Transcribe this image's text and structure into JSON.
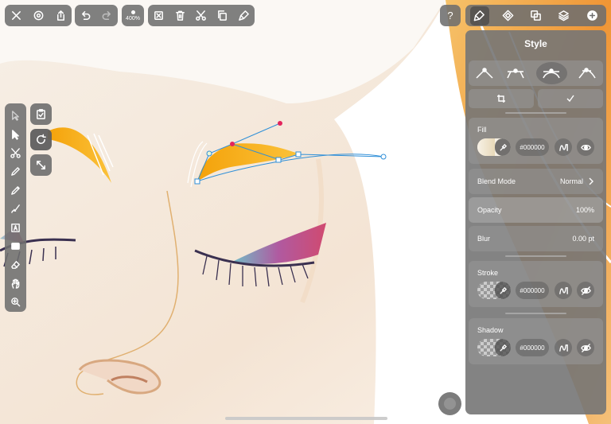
{
  "app": {
    "zoom": "400%"
  },
  "panel": {
    "title": "Style",
    "fill": {
      "label": "Fill",
      "hex": "#000000"
    },
    "blend_mode": {
      "label": "Blend Mode",
      "value": "Normal"
    },
    "opacity": {
      "label": "Opacity",
      "value": "100%"
    },
    "blur": {
      "label": "Blur",
      "value": "0.00 pt"
    },
    "stroke": {
      "label": "Stroke",
      "hex": "#000000"
    },
    "shadow": {
      "label": "Shadow",
      "hex": "#000000"
    }
  },
  "help_label": "?",
  "colors": {
    "toolbar": "#6e6e6e",
    "panel": "#767676",
    "brow": "#f6ad0e",
    "hair_orange": "#ee8a2a",
    "path_blue": "#2f8fd8",
    "node_pink": "#e3245c"
  }
}
